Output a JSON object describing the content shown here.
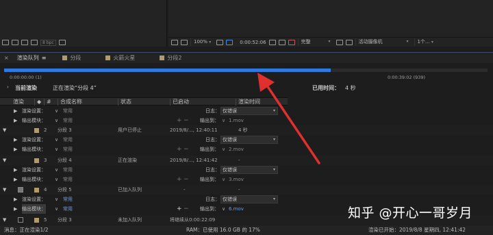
{
  "project_panel": {
    "bpc_label": "8 bpc"
  },
  "comp_toolbar": {
    "zoom": "100%",
    "timecode": "0:00:52:06",
    "resolution": "完整",
    "camera": "活动摄像机",
    "view": "1个..."
  },
  "tabs": [
    {
      "label": "渲染队列",
      "swatch": "",
      "active": true
    },
    {
      "label": "分段",
      "swatch": "#b09b6b",
      "active": false
    },
    {
      "label": "火箭火星",
      "swatch": "#b09b6b",
      "active": false
    },
    {
      "label": "分段2",
      "swatch": "#b09b6b",
      "active": false
    }
  ],
  "progress": {
    "fraction": 0.675,
    "start_time": "0:00:00:00 (1)",
    "end_time": "0:00:39:02 (939)",
    "color": "#2d7be0"
  },
  "status": {
    "current_label": "当前渲染",
    "rendering_text": "正在渲染“分段 4”",
    "elapsed_label": "已用时间：",
    "elapsed_value": "4 秒"
  },
  "columns": [
    "渲染",
    "#",
    "合成名称",
    "状态",
    "已启动",
    "渲染时间"
  ],
  "queue": {
    "settings_label": "渲染设置：",
    "output_label": "输出模块：",
    "log_label": "日志：",
    "output_to_label": "输出到：",
    "common": "常用",
    "errors_only": "仅错误",
    "items": [
      {
        "num": "2",
        "name": "分段 3",
        "status": "用户已停止",
        "started": "2019/8/..., 12:40:11",
        "render_time": "4 秒",
        "output": "1.mov",
        "checked": false
      },
      {
        "num": "3",
        "name": "分段 4",
        "status": "正在渲染",
        "started": "2019/8/..., 12:41:42",
        "render_time": "-",
        "output": "2.mov",
        "checked": false
      },
      {
        "num": "4",
        "name": "分段 5",
        "status": "已加入队列",
        "started": "-",
        "render_time": "-",
        "output": "3.mov",
        "checked": true
      },
      {
        "num": "5",
        "name": "分段 3",
        "status": "未加入队列",
        "started": "将继续从0:00:22:09",
        "render_time": "",
        "output": "6.mov",
        "checked": false
      }
    ],
    "extra_output": "6.mov"
  },
  "bottom": {
    "message": "消息：正在渲染1/2",
    "ram": "RAM：已使用 16.0 GB 的 17%",
    "render_started": "渲染已开始：2019/8/8 星期四, 12:41:42"
  },
  "watermark": "知乎 @开心一哥岁月",
  "annotation_arrow_color": "#e0302e"
}
